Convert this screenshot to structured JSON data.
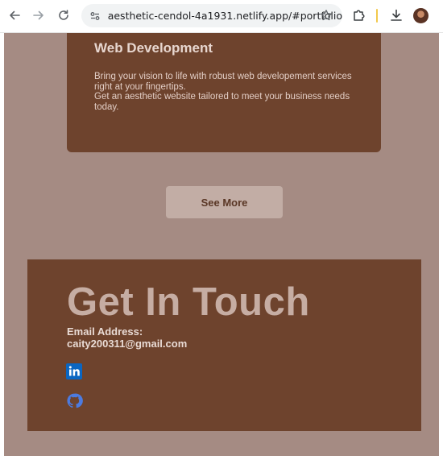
{
  "browser": {
    "url": "aesthetic-cendol-4a1931.netlify.app/#portfolio"
  },
  "service": {
    "title": "Web Development",
    "description_line1": "Bring your vision to life with robust web developement services right at your fingertips.",
    "description_line2": "Get an aesthetic website tailored to meet your business needs today."
  },
  "see_more": {
    "label": "See More"
  },
  "contact": {
    "title": "Get In Touch",
    "email_label": "Email Address:",
    "email": "caity200311@gmail.com"
  },
  "icons": {
    "back": "back-arrow-icon",
    "forward": "forward-arrow-icon",
    "reload": "reload-icon",
    "site_info": "site-info-icon",
    "bookmark": "star-icon",
    "extensions": "puzzle-icon",
    "downloads": "download-icon",
    "linkedin": "linkedin-icon",
    "github": "github-icon"
  },
  "colors": {
    "page_background": "#a58b83",
    "card_background": "#6e432d",
    "button_background": "#c2ada5",
    "linkedin_blue": "#0a66c2",
    "github_blue": "#4c7be0"
  }
}
